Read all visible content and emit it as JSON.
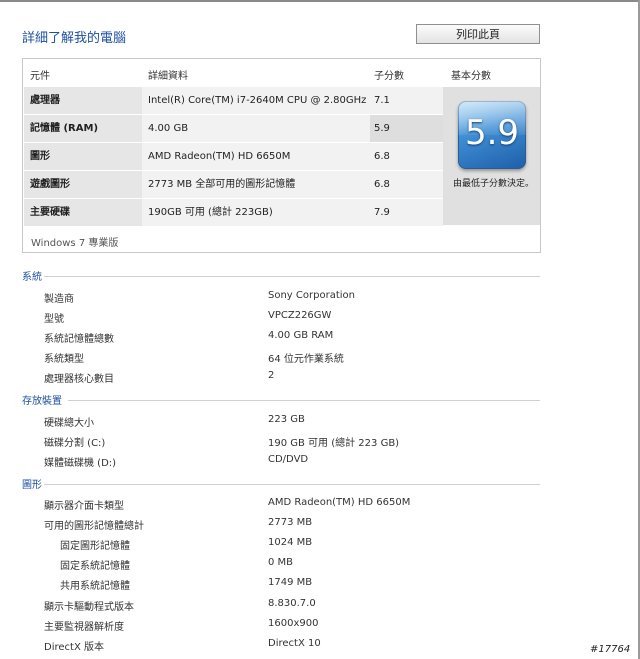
{
  "window": {
    "title": "詳細了解我的電腦",
    "print_label": "列印此頁"
  },
  "score_table": {
    "headers": {
      "component": "元件",
      "details": "詳細資料",
      "subscore": "子分數",
      "base_score": "基本分數"
    },
    "rows": [
      {
        "component": "處理器",
        "details": "Intel(R) Core(TM) i7-2640M CPU @ 2.80GHz",
        "subscore": "7.1"
      },
      {
        "component": "記憶體 (RAM)",
        "details": "4.00 GB",
        "subscore": "5.9"
      },
      {
        "component": "圖形",
        "details": "AMD Radeon(TM) HD 6650M",
        "subscore": "6.8"
      },
      {
        "component": "遊戲圖形",
        "details": "2773 MB 全部可用的圖形記憶體",
        "subscore": "6.8"
      },
      {
        "component": "主要硬碟",
        "details": "190GB 可用 (總計 223GB)",
        "subscore": "7.9"
      }
    ],
    "base_score": "5.9",
    "base_note": "由最低子分數決定。",
    "edition": "Windows 7 專業版"
  },
  "sections": {
    "system": {
      "title": "系統",
      "items": [
        {
          "label": "製造商",
          "value": "Sony Corporation"
        },
        {
          "label": "型號",
          "value": "VPCZ226GW"
        },
        {
          "label": "系統記憶體總數",
          "value": "4.00 GB RAM"
        },
        {
          "label": "系統類型",
          "value": "64 位元作業系統"
        },
        {
          "label": "處理器核心數目",
          "value": "2"
        }
      ]
    },
    "storage": {
      "title": "存放裝置",
      "items": [
        {
          "label": "硬碟總大小",
          "value": "223 GB"
        },
        {
          "label": "磁碟分割 (C:)",
          "value": "190 GB 可用 (總計 223 GB)"
        },
        {
          "label": "媒體磁碟機 (D:)",
          "value": "CD/DVD"
        }
      ]
    },
    "graphics": {
      "title": "圖形",
      "items": [
        {
          "label": "顯示器介面卡類型",
          "value": "AMD Radeon(TM) HD 6650M"
        },
        {
          "label": "可用的圖形記憶體總計",
          "value": "2773 MB"
        },
        {
          "label": "固定圖形記憶體",
          "value": "1024 MB"
        },
        {
          "label": "固定系統記憶體",
          "value": "0 MB"
        },
        {
          "label": "共用系統記憶體",
          "value": "1749 MB"
        },
        {
          "label": "顯示卡驅動程式版本",
          "value": "8.830.7.0"
        },
        {
          "label": "主要監視器解析度",
          "value": "1600x900"
        },
        {
          "label": "DirectX 版本",
          "value": "DirectX 10"
        }
      ]
    }
  },
  "watermark": "#17764"
}
